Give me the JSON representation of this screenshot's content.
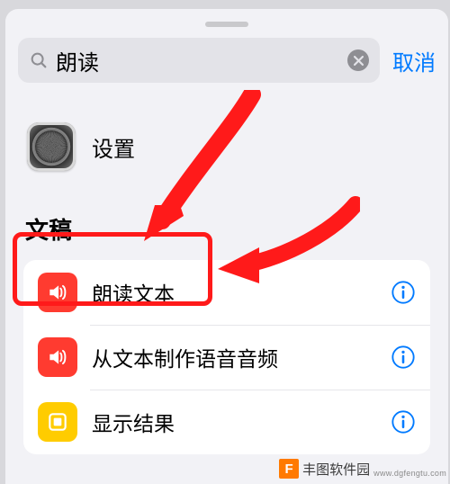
{
  "search": {
    "query": "朗读",
    "cancel": "取消"
  },
  "app": {
    "label": "设置"
  },
  "section": {
    "title": "文稿"
  },
  "rows": [
    {
      "label": "朗读文本"
    },
    {
      "label": "从文本制作语音音频"
    },
    {
      "label": "显示结果"
    }
  ],
  "watermark": {
    "badge": "F",
    "name": "丰图软件园",
    "url": "www.dgfengtu.com"
  }
}
